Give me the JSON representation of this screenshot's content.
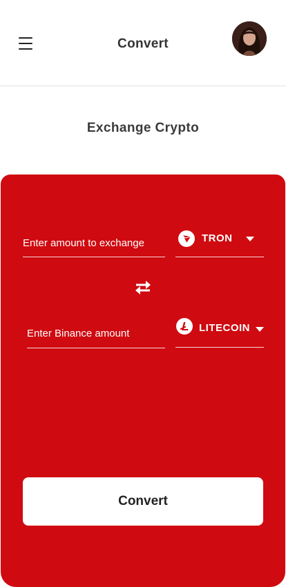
{
  "header": {
    "title": "Convert",
    "menu_icon": "hamburger-menu-icon",
    "avatar": "user-avatar"
  },
  "page": {
    "subtitle": "Exchange Crypto"
  },
  "form": {
    "amount_placeholder": "Enter amount to exchange",
    "from_coin": {
      "label": "TRON",
      "icon": "tron-icon"
    },
    "swap_icon": "swap-arrows-icon",
    "binance_placeholder": "Enter Binance amount",
    "to_coin": {
      "label": "LITECOIN",
      "icon": "litecoin-icon"
    },
    "submit_label": "Convert"
  },
  "colors": {
    "panel": "#cf0a10",
    "button_bg": "#ffffff"
  }
}
